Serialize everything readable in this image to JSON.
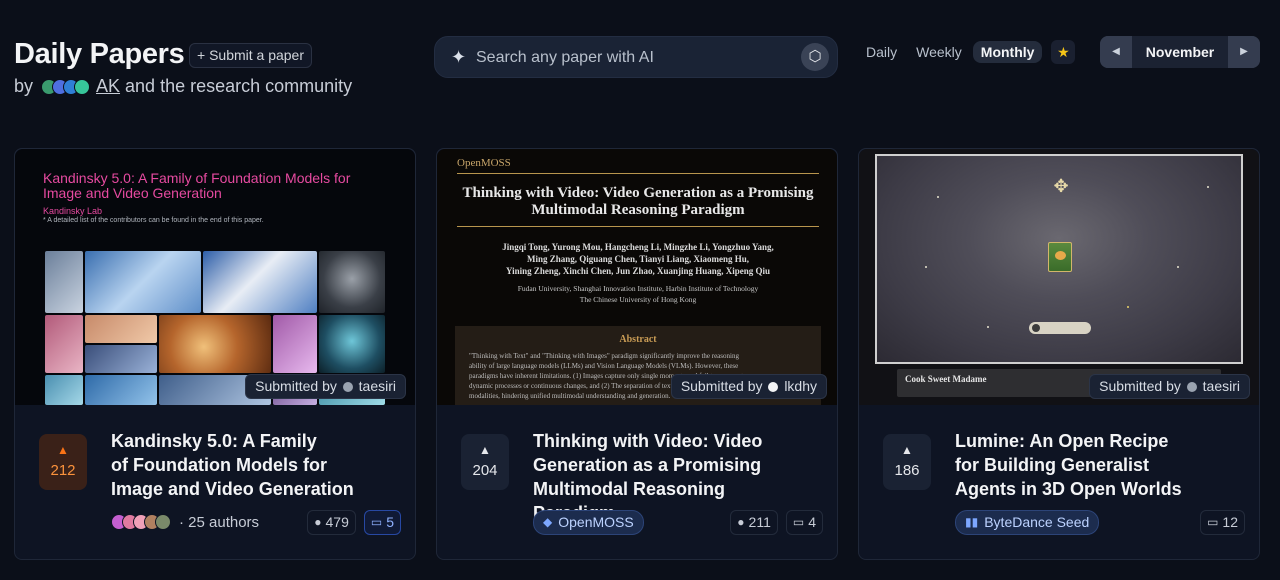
{
  "header": {
    "title": "Daily Papers",
    "submit_label": "+ Submit a paper",
    "by_prefix": "by",
    "by_user": "AK",
    "by_suffix": "and the research community"
  },
  "search": {
    "placeholder": "Search any paper with AI"
  },
  "periods": [
    "Daily",
    "Weekly",
    "Monthly"
  ],
  "active_period": "Monthly",
  "month_nav": {
    "month": "November",
    "prev_icon": "◀",
    "next_icon": "▶"
  },
  "colors": {
    "background": "#0b0f19",
    "accent_orange": "#f97316",
    "accent_blue": "#3b82f6",
    "star": "#f5c518"
  },
  "papers": [
    {
      "title": "Kandinsky 5.0: A Family of Foundation Models for Image and Video Generation",
      "title_lines": [
        "Kandinsky 5.0: A Family",
        "of Foundation Models for",
        "Image and Video Generation"
      ],
      "upvotes": "212",
      "submitted_prefix": "Submitted by",
      "submitter": "taesiri",
      "authors_text": "· 25 authors",
      "github_stars": "479",
      "comments": "5",
      "thumbnail": {
        "title_lines": [
          "Kandinsky 5.0: A Family of Foundation Models for",
          "Image and Video Generation"
        ],
        "lab": "Kandinsky Lab",
        "note": "* A detailed list of the contributors can be found in the end of this paper."
      }
    },
    {
      "title": "Thinking with Video: Video Generation as a Promising Multimodal Reasoning Paradigm",
      "title_lines": [
        "Thinking with Video: Video",
        "Generation as a Promising",
        "Multimodal Reasoning Paradigm"
      ],
      "upvotes": "204",
      "submitted_prefix": "Submitted by",
      "submitter": "lkdhy",
      "org": "OpenMOSS",
      "github_stars": "211",
      "comments": "4",
      "thumbnail": {
        "logo": "OpenMOSS",
        "title_lines": [
          "Thinking with Video: Video Generation as a Promising",
          "Multimodal Reasoning Paradigm"
        ],
        "authors_lines": [
          "Jingqi Tong, Yurong Mou, Hangcheng Li, Mingzhe Li, Yongzhuo Yang,",
          "Ming Zhang, Qiguang Chen, Tianyi Liang, Xiaomeng Hu,",
          "Yining Zheng, Xinchi Chen, Jun Zhao, Xuanjing Huang, Xipeng Qiu"
        ],
        "aff_lines": [
          "Fudan University, Shanghai Innovation Institute, Harbin Institute of Technology",
          "The Chinese University of Hong Kong"
        ],
        "abstract_heading": "Abstract",
        "abstract_lines": [
          "\"Thinking with Text\" and \"Thinking with Images\" paradigm significantly improve the reasoning",
          "ability of large language models (LLMs) and Vision Language Models (VLMs). However, these",
          "paradigms have inherent limitations. (1) Images capture only single moments and fail to represent",
          "dynamic processes or continuous changes, and (2) The separation of text and vision as distinct",
          "modalities, hindering unified multimodal understanding and generation."
        ]
      }
    },
    {
      "title": "Lumine: An Open Recipe for Building Generalist Agents in 3D Open Worlds",
      "title_lines": [
        "Lumine: An Open Recipe",
        "for Building Generalist",
        "Agents in 3D Open Worlds"
      ],
      "upvotes": "186",
      "submitted_prefix": "Submitted by",
      "submitter": "taesiri",
      "org": "ByteDance Seed",
      "comments": "12",
      "thumbnail": {
        "caption": "Cook Sweet Madame"
      }
    }
  ]
}
